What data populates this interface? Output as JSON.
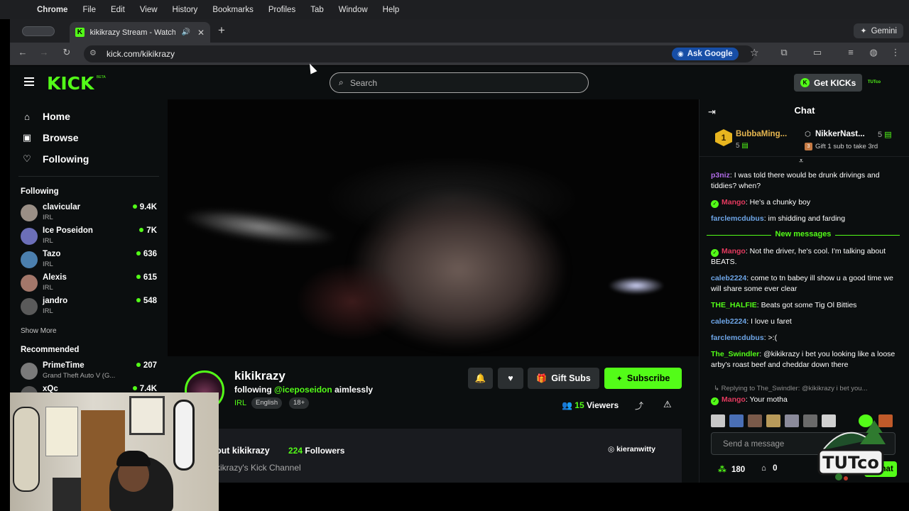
{
  "menubar": {
    "app": "Chrome",
    "items": [
      "File",
      "Edit",
      "View",
      "History",
      "Bookmarks",
      "Profiles",
      "Tab",
      "Window",
      "Help"
    ]
  },
  "browser": {
    "tab_title": "kikikrazy Stream - Watch Live on Kick",
    "gemini_label": "Gemini",
    "url": "kick.com/kikikrazy",
    "ask_google_label": "Ask Google"
  },
  "kick": {
    "logo_text": "KICK",
    "logo_sup": "BETA",
    "search_placeholder": "Search",
    "get_kicks_label": "Get KICKs",
    "user_avatar_text": "TUTco"
  },
  "sidebar": {
    "nav": [
      {
        "label": "Home",
        "icon": "home-icon"
      },
      {
        "label": "Browse",
        "icon": "browse-icon"
      },
      {
        "label": "Following",
        "icon": "heart-icon"
      }
    ],
    "following_header": "Following",
    "following": [
      {
        "name": "clavicular",
        "category": "IRL",
        "viewers": "9.4K",
        "color": "#9a8f86"
      },
      {
        "name": "Ice Poseidon",
        "category": "IRL",
        "viewers": "7K",
        "color": "#6c6fb8"
      },
      {
        "name": "Tazo",
        "category": "IRL",
        "viewers": "636",
        "color": "#4b7fae"
      },
      {
        "name": "Alexis",
        "category": "IRL",
        "viewers": "615",
        "color": "#a3776a"
      },
      {
        "name": "jandro",
        "category": "IRL",
        "viewers": "548",
        "color": "#5a5a5a"
      }
    ],
    "show_more": "Show More",
    "recommended_header": "Recommended",
    "recommended": [
      {
        "name": "PrimeTime",
        "category": "Grand Theft Auto V (G...",
        "viewers": "207",
        "color": "#7a7a7a"
      },
      {
        "name": "xQc",
        "category": "",
        "viewers": "7.4K",
        "color": "#555555"
      }
    ]
  },
  "channel": {
    "name": "kikikrazy",
    "following_prefix": "following",
    "following_handle": "@iceposeidon",
    "following_suffix": "aimlessly",
    "category": "IRL",
    "tags": [
      "English",
      "18+"
    ],
    "gift_subs_label": "Gift Subs",
    "subscribe_label": "Subscribe",
    "viewers_count": "15",
    "viewers_label": "Viewers",
    "about_title": "out kikikrazy",
    "followers_count": "224",
    "followers_label": "Followers",
    "description": "kikrazy's Kick Channel",
    "social": "kieranwitty"
  },
  "chat": {
    "title": "Chat",
    "pinned": {
      "first_rank": "1",
      "first_name": "BubbaMing...",
      "first_count": "5",
      "second_name": "NikkerNast...",
      "second_count": "5",
      "gift_text": "Gift 1 sub to take 3rd"
    },
    "messages_before": [
      {
        "user": "p3niz",
        "color": "#b16ce8",
        "badge": false,
        "text": "I was told there would be drunk drivings and tiddies? when?"
      },
      {
        "user": "Mango",
        "color": "#e33a5e",
        "badge": true,
        "text": "He's a chunky boy"
      },
      {
        "user": "farclemcdubus",
        "color": "#6ea6e8",
        "badge": false,
        "text": "im shidding and farding"
      }
    ],
    "new_messages_label": "New messages",
    "messages_after": [
      {
        "user": "Mango",
        "color": "#e33a5e",
        "badge": true,
        "text": "Not the driver, he's cool. I'm talking about BEATS."
      },
      {
        "user": "caleb2224",
        "color": "#6ea6e8",
        "badge": false,
        "text": "come to tn babey ill show u a good time we will share some ever clear"
      },
      {
        "user": "THE_HALFIE",
        "color": "#53fc18",
        "badge": false,
        "text": "Beats got some Tig Ol Bitties"
      },
      {
        "user": "caleb2224",
        "color": "#6ea6e8",
        "badge": false,
        "text": "I love u faret"
      },
      {
        "user": "farclemcdubus",
        "color": "#6ea6e8",
        "badge": false,
        "text": ">:("
      },
      {
        "user": "The_Swindler",
        "color": "#53fc18",
        "badge": false,
        "text": "@kikikrazy i bet you looking like a loose arby's roast beef and cheddar down there"
      }
    ],
    "reply_line": "Replying to The_Swindler: @kikikrazy i bet you...",
    "last_message": {
      "user": "Mango",
      "color": "#e33a5e",
      "badge": true,
      "text": "Your motha"
    },
    "send_placeholder": "Send a message",
    "points": "180",
    "gifts": "0",
    "chat_button": "Chat",
    "overlay_logo": "TUTco"
  }
}
